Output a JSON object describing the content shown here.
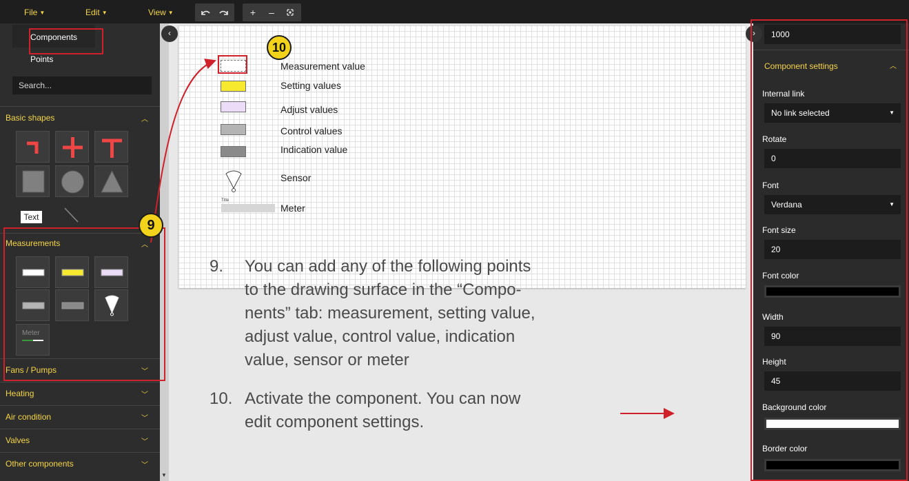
{
  "menubar": {
    "file": "File",
    "edit": "Edit",
    "view": "View",
    "tools": [
      "undo-icon",
      "redo-icon",
      "zoom-in-icon",
      "zoom-out-icon",
      "zoom-fit-icon"
    ]
  },
  "sidebar": {
    "tabs": [
      "Components",
      "Points"
    ],
    "search_placeholder": "Search...",
    "basic_shapes": {
      "title": "Basic shapes",
      "text_tile": "Text"
    },
    "measurements": {
      "title": "Measurements",
      "meter_tile": "Meter"
    },
    "sections": [
      "Fans / Pumps",
      "Heating",
      "Air condition",
      "Valves",
      "Other components"
    ]
  },
  "canvas": {
    "legend": [
      "Measurement value",
      "Setting values",
      "Adjust values",
      "Control values",
      "Indication value",
      "Sensor",
      "Meter"
    ],
    "meter_title": "Title"
  },
  "instructions": {
    "step9_num": "9.",
    "step9_lines": [
      "You can add any of the following points",
      "to the drawing surface in the “Compo-",
      "nents” tab:  measurement, setting value,",
      "adjust value, control value, indication",
      "value, sensor or meter"
    ],
    "step10_num": "10.",
    "step10_lines": [
      "Activate the component. You can now",
      "edit component settings."
    ]
  },
  "badges": {
    "nine": "9",
    "ten": "10"
  },
  "right_panel": {
    "top_value": "1000",
    "section_title": "Component settings",
    "internal_link_label": "Internal link",
    "internal_link_value": "No link selected",
    "rotate_label": "Rotate",
    "rotate_value": "0",
    "font_label": "Font",
    "font_value": "Verdana",
    "font_size_label": "Font size",
    "font_size_value": "20",
    "font_color_label": "Font color",
    "width_label": "Width",
    "width_value": "90",
    "height_label": "Height",
    "height_value": "45",
    "background_color_label": "Background color",
    "border_color_label": "Border color"
  },
  "colors": {
    "accent": "#f5d547",
    "annotation_red": "#d0202a",
    "swatch_setting": "#f7e92e",
    "swatch_adjust": "#ecdcf7",
    "swatch_control": "#b4b4b4",
    "swatch_indication": "#8a8a8a",
    "shape_red": "#f04545"
  }
}
